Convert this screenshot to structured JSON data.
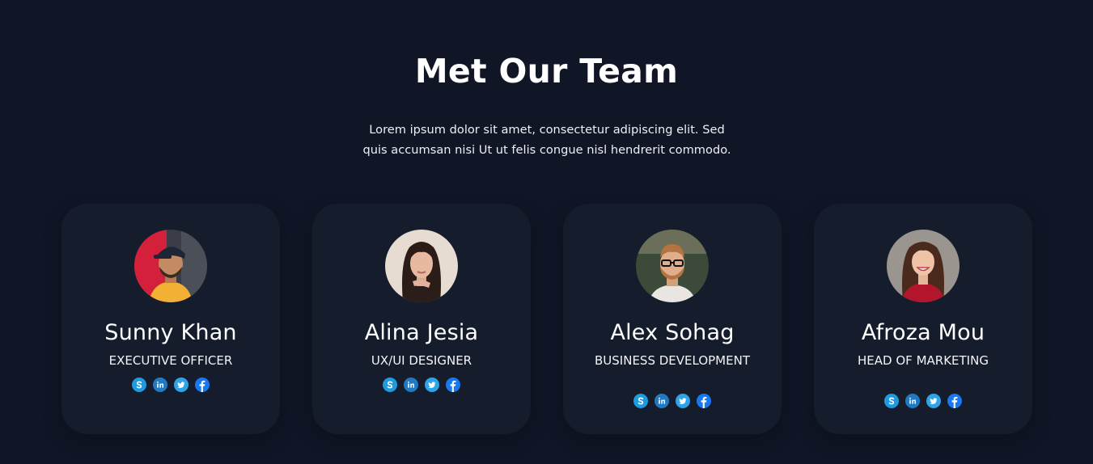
{
  "section": {
    "title": "Met Our Team",
    "description": "Lorem ipsum dolor sit amet, consectetur adipiscing elit. Sed quis accumsan nisi Ut ut felis congue nisl hendrerit commodo."
  },
  "colors": {
    "background": "#101626",
    "card": "#151c2c",
    "skype": "#1e9ae0",
    "linkedin": "#2179c2",
    "twitter": "#2fa3e8",
    "facebook": "#1877f2"
  },
  "social_icons": [
    "skype-icon",
    "linkedin-icon",
    "twitter-icon",
    "facebook-icon"
  ],
  "members": [
    {
      "name": "Sunny Khan",
      "role": "EXECUTIVE OFFICER",
      "avatar": "portrait-man-cap"
    },
    {
      "name": "Alina Jesia",
      "role": "UX/UI DESIGNER",
      "avatar": "portrait-woman-dark-hair"
    },
    {
      "name": "Alex Sohag",
      "role": "BUSINESS DEVELOPMENT",
      "avatar": "portrait-man-glasses"
    },
    {
      "name": "Afroza Mou",
      "role": "HEAD OF MARKETING",
      "avatar": "portrait-woman-red-top"
    }
  ]
}
